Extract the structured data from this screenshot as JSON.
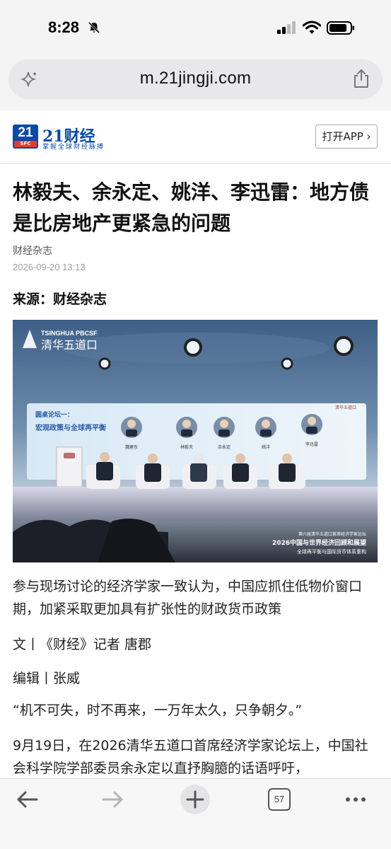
{
  "status": {
    "time": "8:28",
    "icons": [
      "bell-slash-icon",
      "cellular-signal-icon",
      "wifi-icon",
      "battery-icon"
    ]
  },
  "browser": {
    "url": "m.21jingji.com",
    "icons": [
      "sparkle-icon",
      "share-icon"
    ]
  },
  "site": {
    "logo_number": "21",
    "logo_tag": "SFC",
    "logo_name": "21财经",
    "slogan": "掌握全球财经脉搏",
    "open_app": "打开APP ›",
    "brand_color": "#0a4aa6"
  },
  "article": {
    "title": "林毅夫、余永定、姚洋、李迅雷：地方债是比房地产更紧急的问题",
    "source_name": "财经杂志",
    "date": "2026-09-20 13:13",
    "source_line": "来源：财经杂志",
    "photo": {
      "brand_en": "TSINGHUA PBCSF",
      "brand_cn": "清华五道口",
      "panel_title": "圆桌论坛一：",
      "panel_topic": "宏观政策与全球再平衡",
      "speakers": [
        "魏建东",
        "林毅夫",
        "余永定",
        "姚洋",
        "李迅雷"
      ],
      "screen_logo": "清华五道口",
      "event_line1": "第六届清华五道口首席经济学家论坛",
      "event_line2": "2026中国与世界经济回顾和展望",
      "event_line3": "全球再平衡与国际货币体系重构"
    },
    "summary": "参与现场讨论的经济学家一致认为，中国应抓住低物价窗口期，加紧采取更加具有扩张性的财政货币政策",
    "byline": "文丨《财经》记者 唐郡",
    "editor": "编辑丨张威",
    "quote": "“机不可失，时不再来，一万年太久，只争朝夕。”",
    "body": "9月19日，在2026清华五道口首席经济学家论坛上，中国社会科学院学部委员余永定以直抒胸臆的话语呼吁，"
  },
  "toolbar": {
    "tab_count": "57",
    "icons": [
      "back-arrow-icon",
      "forward-arrow-icon",
      "plus-icon",
      "tabs-icon",
      "more-icon"
    ]
  }
}
